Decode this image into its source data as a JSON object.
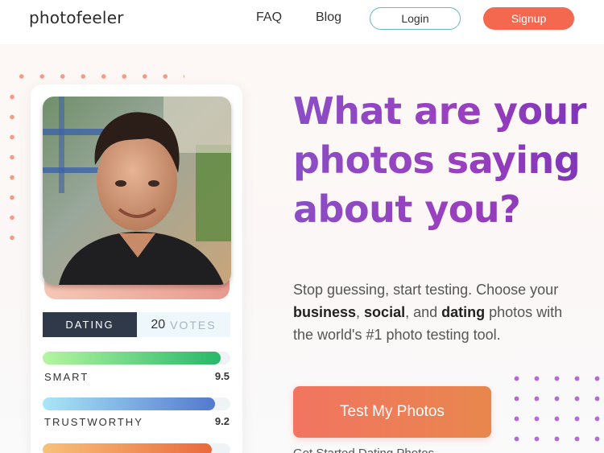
{
  "nav": {
    "logo": "photofeeler",
    "links": [
      "FAQ",
      "Blog"
    ],
    "login": "Login",
    "signup": "Signup"
  },
  "card": {
    "tab": "DATING",
    "votes_count": "20",
    "votes_label": "VOTES",
    "traits": [
      {
        "label": "SMART",
        "score": "9.5",
        "fill_fraction": 0.95,
        "color_start": "#b5f5a0",
        "color_end": "#27b86a"
      },
      {
        "label": "TRUSTWORTHY",
        "score": "9.2",
        "fill_fraction": 0.92,
        "color_start": "#a9e6f7",
        "color_end": "#5379cf"
      },
      {
        "label": "",
        "score": "",
        "fill_fraction": 0.9,
        "color_start": "#f7c27a",
        "color_end": "#ea6a3d"
      }
    ]
  },
  "hero": {
    "headline_line1": "What are your",
    "headline_line2": "photos saying",
    "headline_line3": "about you?",
    "sub_pre": "Stop guessing, start testing. Choose your",
    "sub_bold1": "business",
    "sub_sep1": ", ",
    "sub_bold2": "social",
    "sub_sep2": ", and ",
    "sub_bold3": "dating",
    "sub_post1": " photos with",
    "sub_post2": "the world's #1 photo testing tool.",
    "cta": "Test My Photos",
    "cta_sub": "Get Started Dating Photos"
  },
  "colors": {
    "brand_orange": "#f4684f",
    "login_border": "#62b7c2",
    "headline_purple": "#8a4ec4",
    "tab_dark": "#2f3949"
  }
}
